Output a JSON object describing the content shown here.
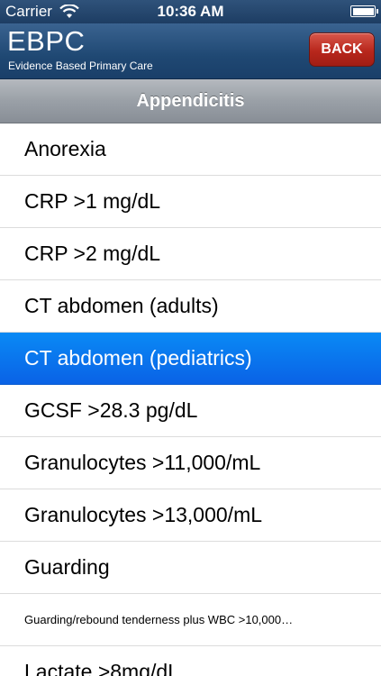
{
  "status_bar": {
    "carrier": "Carrier",
    "time": "10:36 AM"
  },
  "header": {
    "title": "EBPC",
    "subtitle": "Evidence Based Primary Care",
    "back_label": "BACK"
  },
  "section": {
    "title": "Appendicitis"
  },
  "list": {
    "items": [
      "Anorexia",
      "CRP >1 mg/dL",
      "CRP >2 mg/dL",
      "CT abdomen (adults)",
      "CT abdomen (pediatrics)",
      "GCSF >28.3 pg/dL",
      "Granulocytes >11,000/mL",
      "Granulocytes >13,000/mL",
      "Guarding",
      "Guarding/rebound tenderness plus WBC >10,000…",
      "Lactate >8mg/dL"
    ],
    "selected_index": 4
  },
  "colors": {
    "header_blue": "#1f4873",
    "back_red": "#b8271c",
    "selection_blue": "#0a7af0",
    "section_gray": "#9aa0a7"
  }
}
